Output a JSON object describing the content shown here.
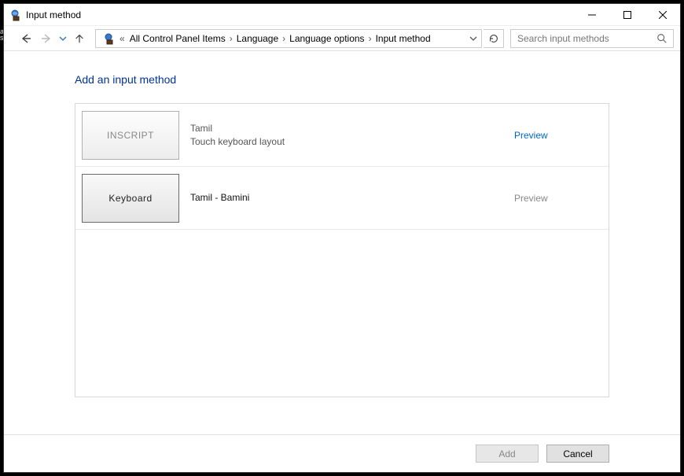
{
  "window": {
    "title": "Input method"
  },
  "breadcrumb": {
    "items": [
      "All Control Panel Items",
      "Language",
      "Language options",
      "Input method"
    ]
  },
  "search": {
    "placeholder": "Search input methods"
  },
  "page": {
    "heading": "Add an input method"
  },
  "items": [
    {
      "thumb_label": "INSCRIPT",
      "line1": "Tamil",
      "line2": "Touch keyboard layout",
      "preview_label": "Preview",
      "preview_enabled": true,
      "selected": false
    },
    {
      "thumb_label": "Keyboard",
      "line1": "Tamil - Bamini",
      "line2": "",
      "preview_label": "Preview",
      "preview_enabled": false,
      "selected": true
    }
  ],
  "buttons": {
    "add": "Add",
    "cancel": "Cancel"
  }
}
